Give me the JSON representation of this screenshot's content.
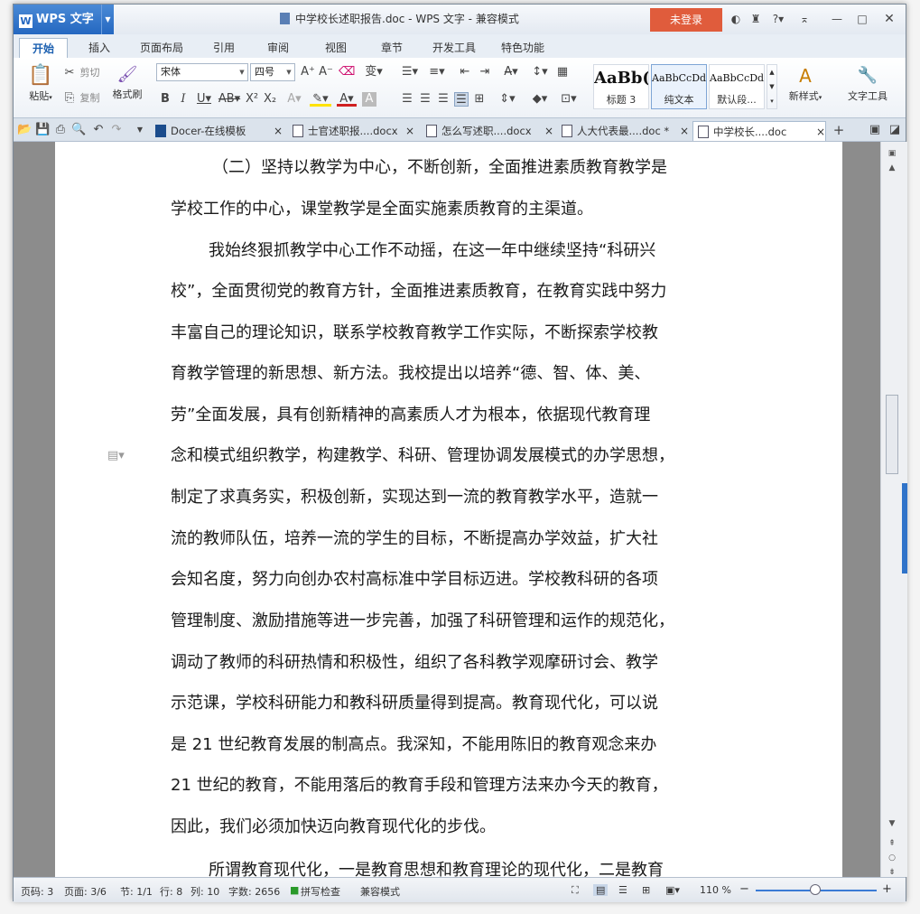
{
  "app": {
    "name": "WPS 文字",
    "logo_letter": "W"
  },
  "window": {
    "title": "中学校长述职报告.doc - WPS 文字 - 兼容模式",
    "login_label": "未登录"
  },
  "ribbon_tabs": [
    "开始",
    "插入",
    "页面布局",
    "引用",
    "审阅",
    "视图",
    "章节",
    "开发工具",
    "特色功能"
  ],
  "ribbon": {
    "paste": "粘贴",
    "cut": "剪切",
    "copy": "复制",
    "format_painter": "格式刷",
    "font_name": "宋体",
    "font_size": "四号",
    "styles": [
      {
        "sample": "AaBb(",
        "name": "标题 3"
      },
      {
        "sample": "AaBbCcDd",
        "name": "纯文本"
      },
      {
        "sample": "AaBbCcDd",
        "name": "默认段..."
      }
    ],
    "new_style": "新样式",
    "text_tools": "文字工具"
  },
  "doc_tabs": [
    {
      "label": "Docer-在线模板",
      "active": false
    },
    {
      "label": "士官述职报....docx",
      "active": false
    },
    {
      "label": "怎么写述职....docx",
      "active": false
    },
    {
      "label": "人大代表最....doc *",
      "active": false
    },
    {
      "label": "中学校长....doc",
      "active": true
    }
  ],
  "document": {
    "lines": [
      "（二）坚持以教学为中心，不断创新，全面推进素质教育教学是",
      "学校工作的中心，课堂教学是全面实施素质教育的主渠道。",
      "我始终狠抓教学中心工作不动摇，在这一年中继续坚持“科研兴",
      "校”，全面贯彻党的教育方针，全面推进素质教育，在教育实践中努力",
      "丰富自己的理论知识，联系学校教育教学工作实际，不断探索学校教",
      "育教学管理的新思想、新方法。我校提出以培养“德、智、体、美、",
      "劳”全面发展，具有创新精神的高素质人才为根本，依据现代教育理",
      "念和模式组织教学，构建教学、科研、管理协调发展模式的办学思想，",
      "制定了求真务实，积极创新，实现达到一流的教育教学水平，造就一",
      "流的教师队伍，培养一流的学生的目标，不断提高办学效益，扩大社",
      "会知名度，努力向创办农村高标准中学目标迈进。学校教科研的各项",
      "管理制度、激励措施等进一步完善，加强了科研管理和运作的规范化，",
      "调动了教师的科研热情和积极性，组织了各科教学观摩研讨会、教学",
      "示范课，学校科研能力和教科研质量得到提高。教育现代化，可以说",
      "是 21 世纪教育发展的制高点。我深知，不能用陈旧的教育观念来办",
      "21 世纪的教育，不能用落后的教育手段和管理方法来办今天的教育，",
      "因此，我们必须加快迈向教育现代化的步伐。",
      "所谓教育现代化，一是教育思想和教育理论的现代化，二是教育"
    ]
  },
  "status": {
    "page_no": "页码: 3",
    "pages": "页面: 3/6",
    "section": "节: 1/1",
    "row": "行: 8",
    "col": "列: 10",
    "word_count": "字数: 2656",
    "spell_check": "拼写检查",
    "compat": "兼容模式",
    "zoom": "110 %"
  }
}
